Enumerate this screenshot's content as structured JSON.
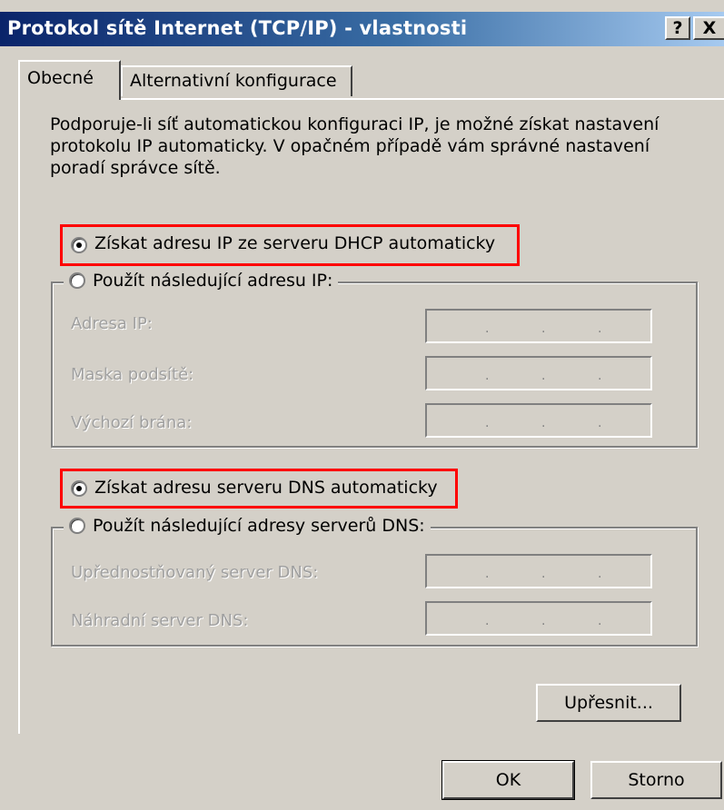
{
  "window": {
    "title": "Protokol sítě Internet (TCP/IP) - vlastnosti",
    "help_button": "?",
    "close_button": "X"
  },
  "tabs": [
    {
      "label": "Obecné",
      "active": true
    },
    {
      "label": "Alternativní konfigurace",
      "active": false
    }
  ],
  "intro_text": "Podporuje-li síť automatickou konfiguraci IP, je možné získat nastavení protokolu IP automaticky. V opačném případě vám správné nastavení poradí správce sítě.",
  "ip": {
    "auto_label": "Získat adresu IP ze serveru DHCP automaticky",
    "auto_selected": true,
    "manual_label": "Použít následující adresu IP:",
    "fields": [
      {
        "label": "Adresa IP:"
      },
      {
        "label": "Maska podsítě:"
      },
      {
        "label": "Výchozí brána:"
      }
    ]
  },
  "dns": {
    "auto_label": "Získat adresu serveru DNS automaticky",
    "auto_selected": true,
    "manual_label": "Použít následující adresy serverů DNS:",
    "fields": [
      {
        "label": "Upřednostňovaný server DNS:"
      },
      {
        "label": "Náhradní server DNS:"
      }
    ]
  },
  "buttons": {
    "advanced": "Upřesnit...",
    "ok": "OK",
    "cancel": "Storno"
  },
  "highlight_color": "#ff0000"
}
